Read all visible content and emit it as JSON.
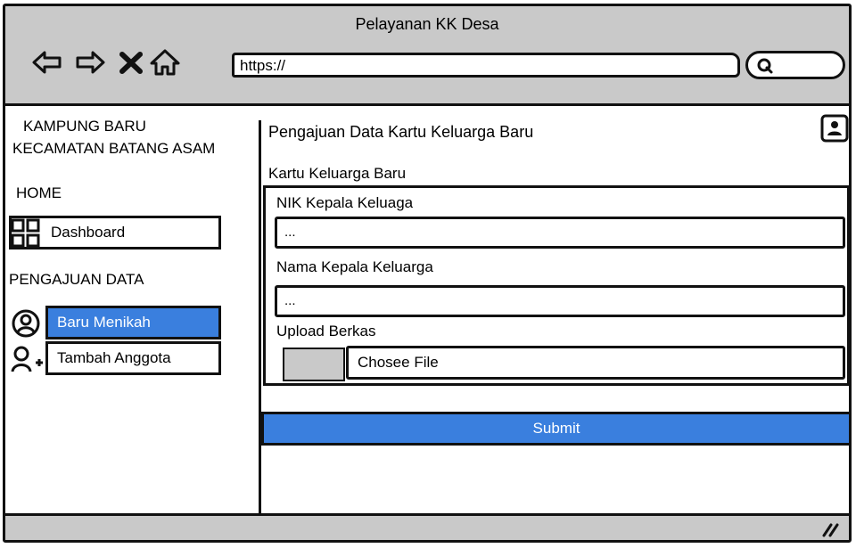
{
  "window": {
    "title": "Pelayanan KK Desa"
  },
  "browser": {
    "url": "https://"
  },
  "sidebar": {
    "org_line1": "KAMPUNG BARU",
    "org_line2": "KECAMATAN BATANG ASAM",
    "home_label": "HOME",
    "dashboard_label": "Dashboard",
    "section_label": "PENGAJUAN DATA",
    "items": [
      {
        "label": "Baru Menikah",
        "active": true
      },
      {
        "label": "Tambah Anggota",
        "active": false
      }
    ]
  },
  "main": {
    "title": "Pengajuan Data Kartu Keluarga Baru",
    "section_title": "Kartu Keluarga Baru",
    "fields": [
      {
        "label": "NIK Kepala Keluaga",
        "value": "..."
      },
      {
        "label": "Nama Kepala Keluarga",
        "value": "..."
      }
    ],
    "upload": {
      "label": "Upload Berkas",
      "file_text": "Chosee File"
    },
    "submit_label": "Submit"
  },
  "colors": {
    "accent": "#3a7fde",
    "chrome": "#c9c9c9"
  }
}
